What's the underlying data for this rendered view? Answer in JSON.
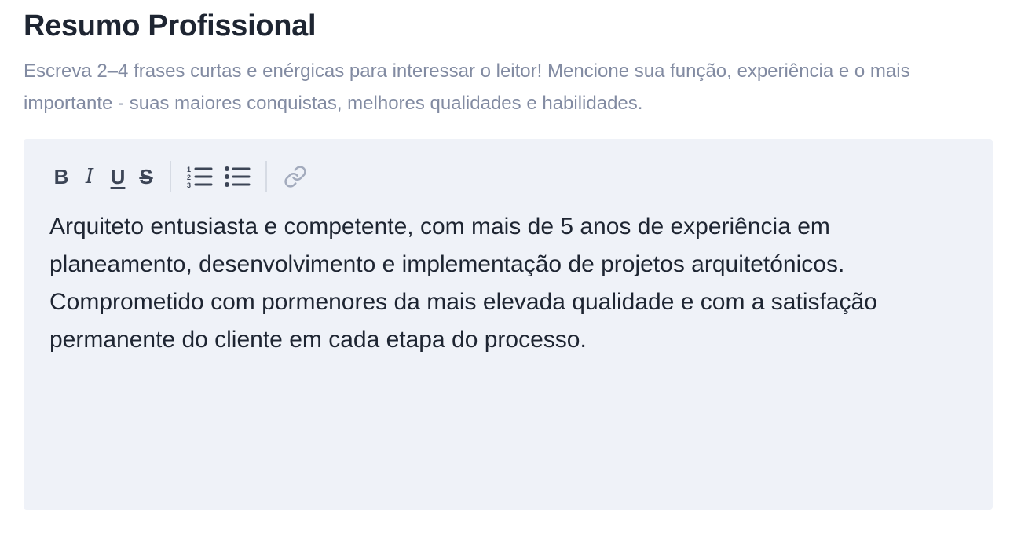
{
  "section": {
    "title": "Resumo Profissional",
    "hint": "Escreva 2–4 frases curtas e enérgicas para interessar o leitor! Mencione sua função, experiência e o mais importante - suas maiores conquistas, melhores qualidades e habilidades."
  },
  "toolbar": {
    "bold_label": "B",
    "italic_label": "I",
    "underline_label": "U",
    "strike_label": "S",
    "icons": [
      "bold-icon",
      "italic-icon",
      "underline-icon",
      "strikethrough-icon",
      "ordered-list-icon",
      "bullet-list-icon",
      "link-icon"
    ]
  },
  "editor": {
    "content": "Arquiteto entusiasta e competente, com mais de 5 anos de experiência em planeamento, desenvolvimento e implementação de projetos arquitetónicos. Comprometido com pormenores da mais elevada qualidade e com a satisfação permanente do cliente em cada etapa do processo."
  },
  "colors": {
    "editor_background": "#eff2f8",
    "title": "#1e2532",
    "hint": "#828ba2",
    "toolbar_icon": "#3c4556",
    "toolbar_icon_disabled": "#a3abbd",
    "divider": "#d6dbe4"
  }
}
